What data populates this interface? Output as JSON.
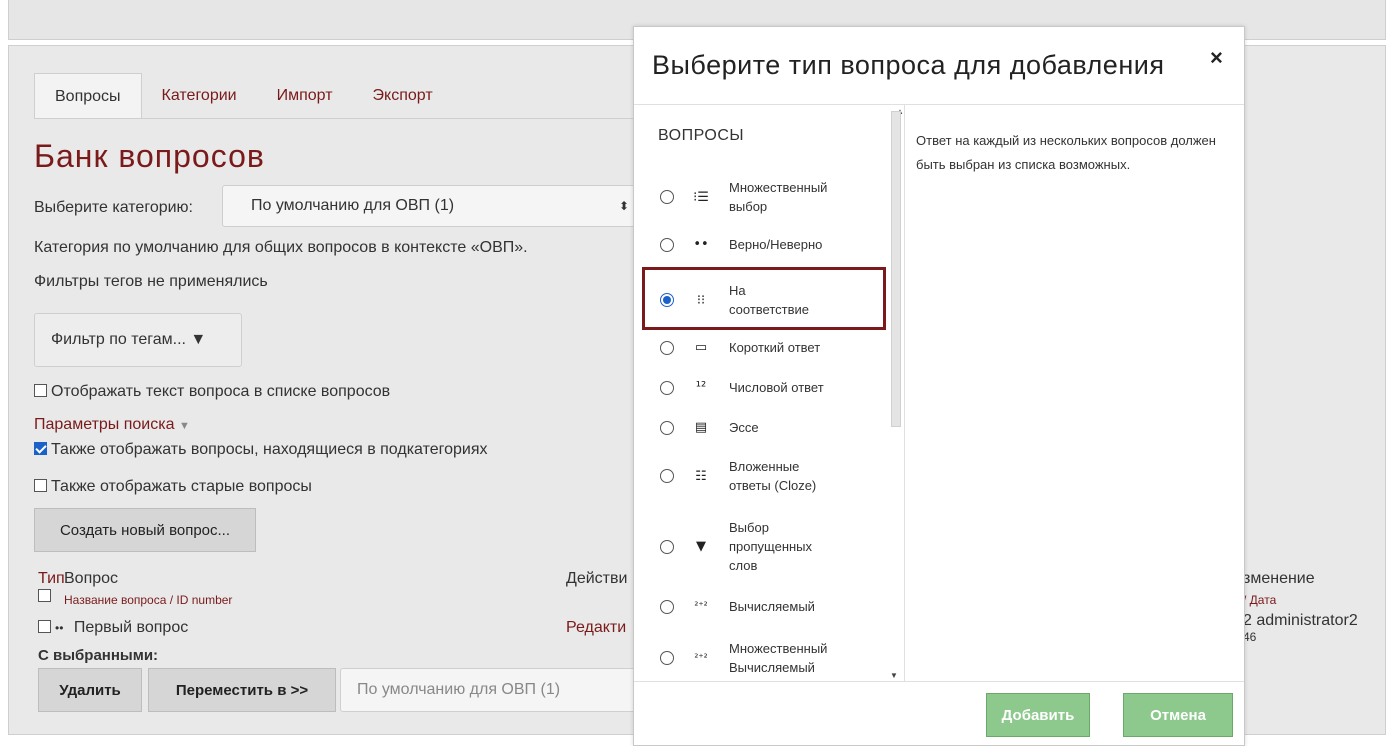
{
  "tabs": [
    "Вопросы",
    "Категории",
    "Импорт",
    "Экспорт"
  ],
  "page_title": "Банк вопросов",
  "category": {
    "label": "Выберите категорию:",
    "selected": "По умолчанию для ОВП (1)",
    "note": "Категория по умолчанию для общих вопросов в контексте «ОВП»."
  },
  "tags_note": "Фильтры тегов не применялись",
  "tag_filter_label": "Фильтр по тегам... ▼",
  "show_text_checkbox": "Отображать текст вопроса в списке вопросов",
  "search_params_link": "Параметры поиска",
  "subcategories_checkbox": "Также отображать вопросы, находящиеся в подкатегориях",
  "old_questions_checkbox": "Также отображать старые вопросы",
  "create_button": "Создать новый вопрос...",
  "table": {
    "col_type": "Тип",
    "col_question": "Вопрос",
    "col_name_link": "Название вопроса / ID number",
    "col_actions": "Действи",
    "col_change": "зменение",
    "col_date_link": "/ Дата",
    "row_name": "Первый вопрос",
    "row_edit": "Редакти",
    "row_user": "2 administrator2",
    "row_time": "46"
  },
  "with_selected": "С выбранными:",
  "delete_button": "Удалить",
  "move_button": "Переместить в >>",
  "move_select": "По умолчанию для ОВП (1)",
  "modal": {
    "title": "Выберите тип вопроса для добавления",
    "close": "×",
    "section": "ВОПРОСЫ",
    "description": "Ответ на каждый из нескольких вопросов должен быть выбран из списка возможных.",
    "add_button": "Добавить",
    "cancel_button": "Отмена",
    "items": [
      {
        "label1": "Множественный",
        "label2": "выбор",
        "icon": "list-icon",
        "glyph": "⁝☰"
      },
      {
        "label1": "Верно/Неверно",
        "label2": "",
        "icon": "true-false-icon",
        "glyph": "••"
      },
      {
        "label1": "На",
        "label2": "соответствие",
        "icon": "matching-icon",
        "glyph": "⁝⁝"
      },
      {
        "label1": "Короткий ответ",
        "label2": "",
        "icon": "short-answer-icon",
        "glyph": "▭"
      },
      {
        "label1": "Числовой ответ",
        "label2": "",
        "icon": "numerical-icon",
        "glyph": "¹²"
      },
      {
        "label1": "Эссе",
        "label2": "",
        "icon": "essay-icon",
        "glyph": "▤"
      },
      {
        "label1": "Вложенные",
        "label2": "ответы (Cloze)",
        "icon": "cloze-icon",
        "glyph": "☷"
      },
      {
        "label1": "Выбор",
        "label2": "пропущенных",
        "label3": "слов",
        "icon": "dropdown-icon",
        "glyph": "▼"
      },
      {
        "label1": "Вычисляемый",
        "label2": "",
        "icon": "calculated-icon",
        "glyph": "²⁺²"
      },
      {
        "label1": "Множественный",
        "label2": "Вычисляемый",
        "icon": "calculated-multi-icon",
        "glyph": "²⁺²"
      }
    ]
  }
}
